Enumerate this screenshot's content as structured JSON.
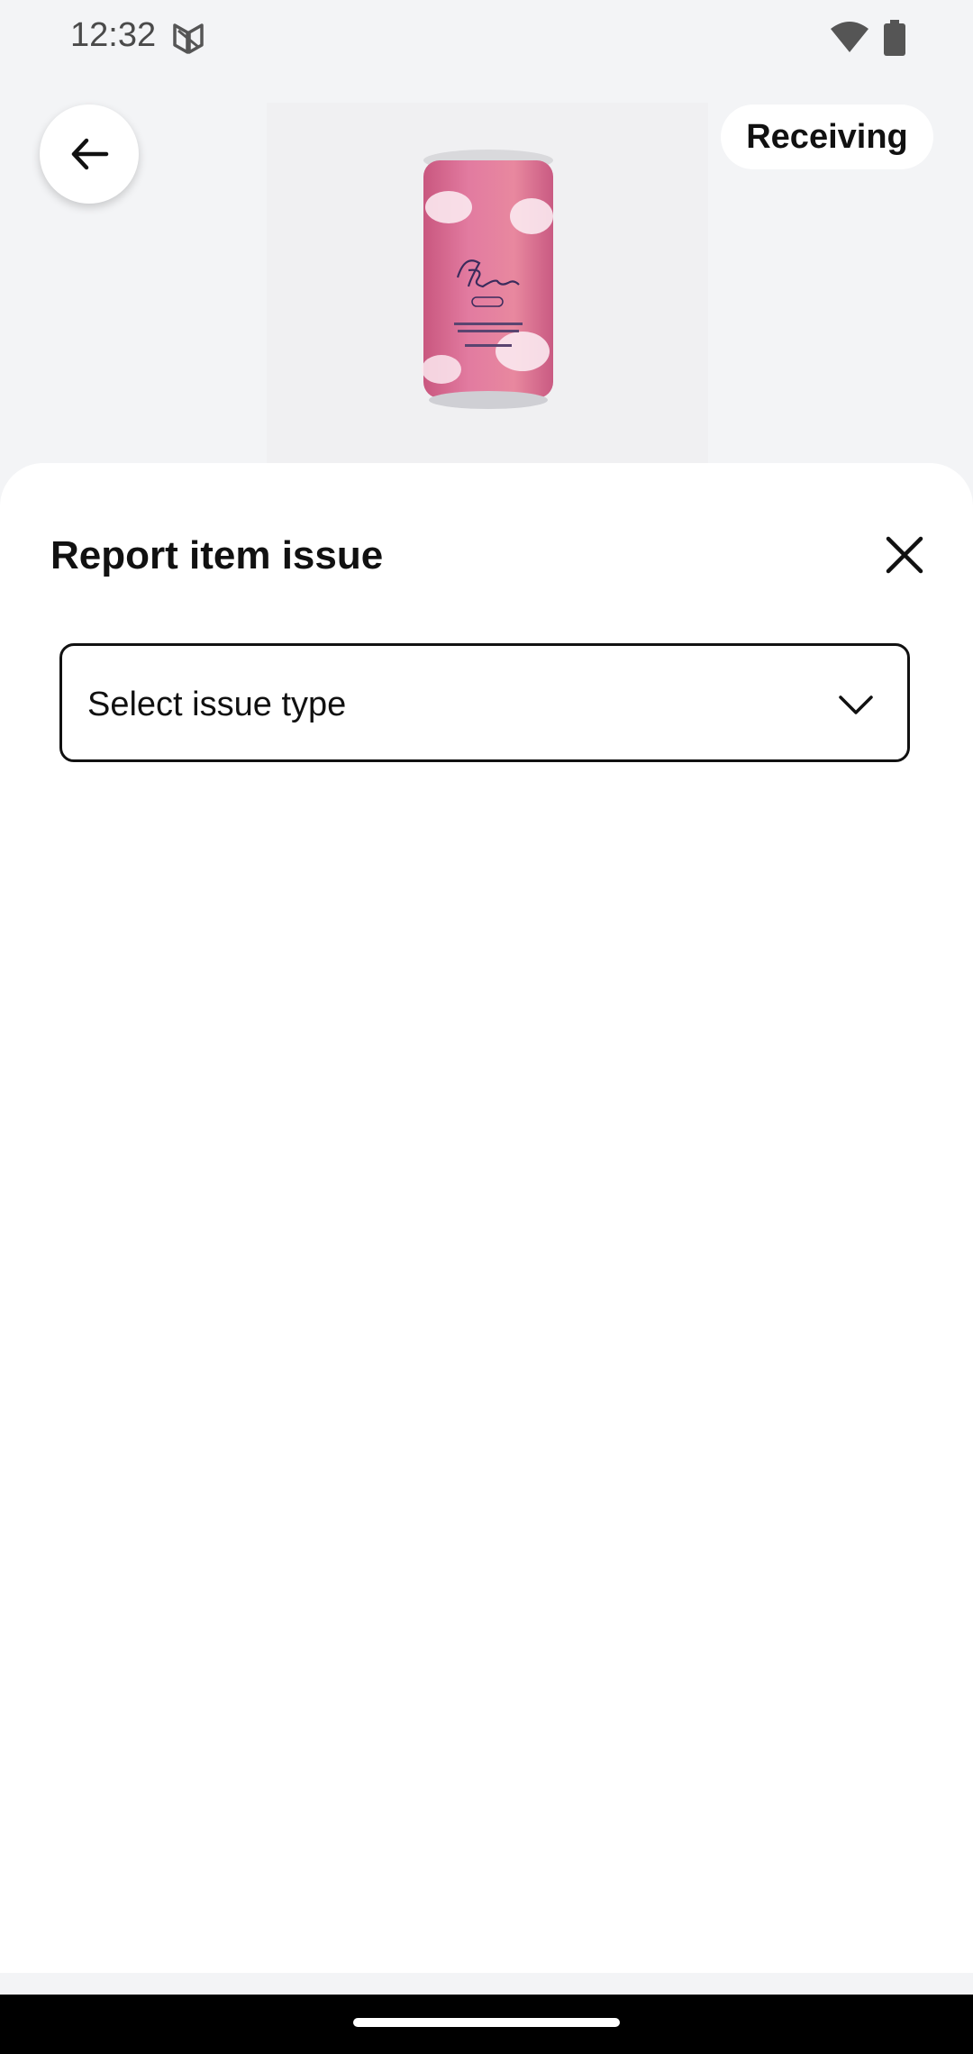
{
  "status_bar": {
    "time": "12:32",
    "icons": [
      "app-notification-icon",
      "wifi-icon",
      "battery-icon"
    ]
  },
  "header": {
    "back_icon": "arrow-left-icon",
    "status_pill_label": "Receiving",
    "product_image": "recess-can-image"
  },
  "sheet": {
    "title": "Report item issue",
    "close_icon": "close-icon",
    "issue_select": {
      "placeholder": "Select issue type",
      "chevron_icon": "chevron-down-icon"
    }
  },
  "colors": {
    "background": "#f3f4f6",
    "sheet": "#ffffff",
    "text": "#111111",
    "can_pink": "#e2739a"
  }
}
